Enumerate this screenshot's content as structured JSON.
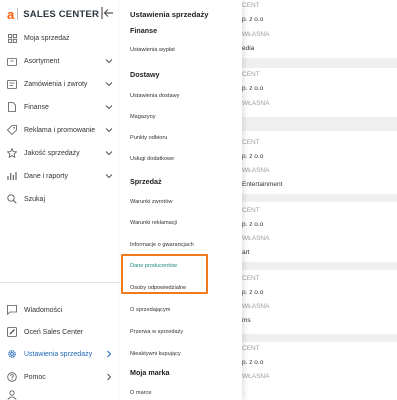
{
  "brand": {
    "logo": "a",
    "name": "SALES CENTER"
  },
  "sidebar": {
    "items": [
      {
        "label": "Moja sprzedaż"
      },
      {
        "label": "Asortyment"
      },
      {
        "label": "Zamówienia i zwroty"
      },
      {
        "label": "Finanse"
      },
      {
        "label": "Reklama i promowanie"
      },
      {
        "label": "Jakość sprzedaży"
      },
      {
        "label": "Dane i raporty"
      },
      {
        "label": "Szukaj"
      }
    ],
    "bottom_items": [
      {
        "label": "Wiadomości"
      },
      {
        "label": "Oceń Sales Center"
      },
      {
        "label": "Ustawienia sprzedaży"
      },
      {
        "label": "Pomoc"
      }
    ]
  },
  "panel": {
    "title": "Ustawienia sprzedaży",
    "sections": [
      {
        "title": "Finanse",
        "items": [
          "Ustawienia wypłat"
        ]
      },
      {
        "title": "Dostawy",
        "items": [
          "Ustawienia dostawy",
          "Magazyny",
          "Punkty odbioru",
          "Usługi dodatkowe"
        ]
      },
      {
        "title": "Sprzedaż",
        "items": [
          "Warunki zwrotów",
          "Warunki reklamacji",
          "Informacje o gwarancjach",
          "Dane producentów",
          "Osoby odpowiedzialne",
          "O sprzedającym",
          "Przerwa w sprzedaży",
          "Nieaktywni kupujący"
        ]
      },
      {
        "title": "Moja marka",
        "items": [
          "O marce"
        ]
      }
    ]
  },
  "background": {
    "lines": [
      "CENT",
      "p. z o.o",
      "WŁASNA",
      "edia",
      "CENT",
      "p. z o.o",
      "WŁASNA",
      "CENT",
      "p. z o.o",
      "WŁASNA",
      "Entertainment",
      "CENT",
      "p. z o.o",
      "WŁASNA",
      "art",
      "CENT",
      "p. z o.o",
      "WŁASNA",
      "ms",
      "CENT",
      "p. z o.o",
      "WŁASNA"
    ]
  },
  "colors": {
    "accent": "#1f66b5",
    "brand": "#ff5a00",
    "highlight": "#f07a1e",
    "link": "#1a8a78"
  }
}
